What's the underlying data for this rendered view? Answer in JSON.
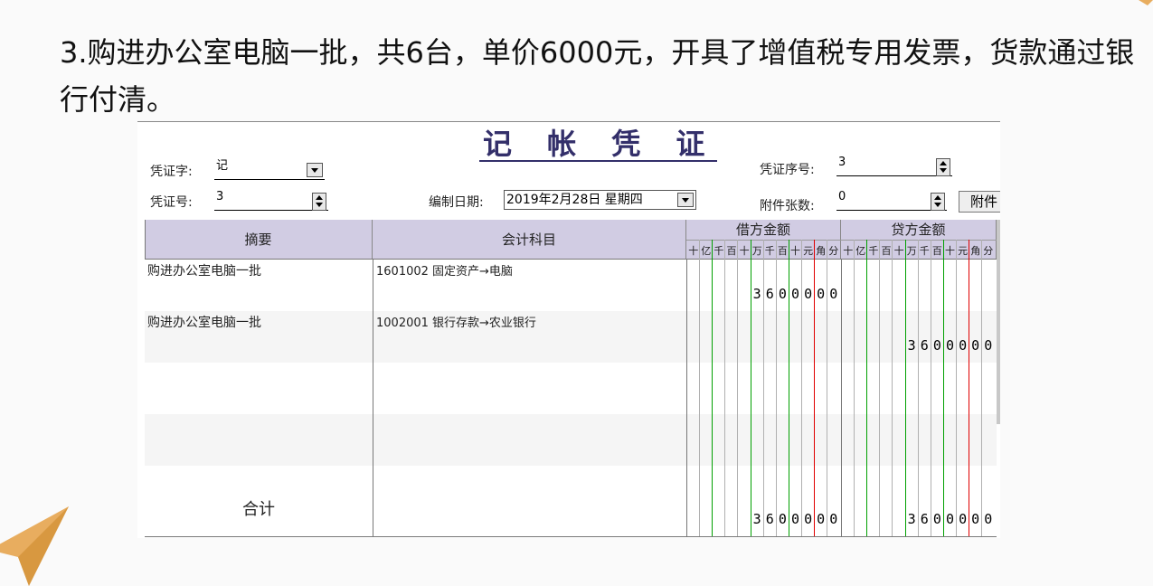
{
  "slide": {
    "title": "3.购进办公室电脑一批，共6台，单价6000元，开具了增值税专用发票，货款通过银行付清。"
  },
  "voucher": {
    "title": "记 帐 凭 证",
    "fields": {
      "voucher_word_label": "凭证字:",
      "voucher_word_value": "记",
      "voucher_no_label": "凭证号:",
      "voucher_no_value": "3",
      "date_label": "编制日期:",
      "date_value": "2019年2月28日 星期四",
      "seq_label": "凭证序号:",
      "seq_value": "3",
      "attach_count_label": "附件张数:",
      "attach_count_value": "0",
      "attach_button": "附件"
    },
    "table": {
      "headers": {
        "summary": "摘要",
        "account": "会计科目",
        "debit": "借方金额",
        "credit": "贷方金额"
      },
      "digit_labels": [
        "十",
        "亿",
        "千",
        "百",
        "十",
        "万",
        "千",
        "百",
        "十",
        "元",
        "角",
        "分"
      ],
      "rows": [
        {
          "summary": "购进办公室电脑一批",
          "account": "1601002  固定资产→电脑",
          "debit": "3600000",
          "credit": ""
        },
        {
          "summary": "购进办公室电脑一批",
          "account": "1002001  银行存款→农业银行",
          "debit": "",
          "credit": "3600000"
        },
        {
          "summary": "",
          "account": "",
          "debit": "",
          "credit": ""
        },
        {
          "summary": "",
          "account": "",
          "debit": "",
          "credit": ""
        },
        {
          "summary": "",
          "account": "",
          "debit": "",
          "credit": ""
        }
      ],
      "total": {
        "label": "合计",
        "debit": "3600000",
        "credit": "3600000"
      }
    }
  },
  "colors": {
    "header_bg": "#d1cce3",
    "title_color": "#332f6a",
    "divider_green": "#00a000",
    "divider_red": "#e00000",
    "decoration_orange": "#e8ad5f"
  }
}
